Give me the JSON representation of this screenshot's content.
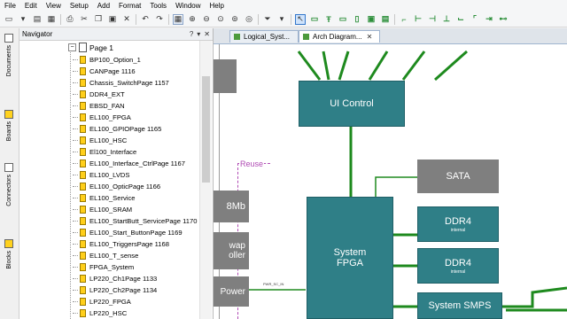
{
  "menu": [
    "File",
    "Edit",
    "View",
    "Setup",
    "Add",
    "Format",
    "Tools",
    "Window",
    "Help"
  ],
  "navigator": {
    "title": "Navigator",
    "buttons": [
      "?",
      "▾",
      "✕"
    ],
    "page_label": "Page 1",
    "items": [
      "BP100_Option_1",
      "CANPage 1116",
      "Chassis_SwitchPage 1157",
      "DDR4_EXT",
      "EBSD_FAN",
      "EL100_FPGA",
      "EL100_GPIOPage 1165",
      "EL100_HSC",
      "El100_Interface",
      "EL100_Interface_CtrlPage 1167",
      "EL100_LVDS",
      "EL100_OpticPage 1166",
      "EL100_Service",
      "EL100_SRAM",
      "EL100_StartButt_ServicePage 1170",
      "EL100_Start_ButtonPage 1169",
      "EL100_TriggersPage 1168",
      "EL100_T_sense",
      "FPGA_System",
      "LP220_Ch1Page 1133",
      "LP220_Ch2Page 1134",
      "LP220_FPGA",
      "LP220_HSC"
    ]
  },
  "sidebar_tabs": [
    "Documents",
    "Boards",
    "Connectors",
    "Blocks"
  ],
  "tabs": [
    {
      "label": "Logical_Syst...",
      "active": false
    },
    {
      "label": "Arch Diagram...",
      "active": true,
      "close": "✕"
    }
  ],
  "diagram": {
    "reuse_label": "Reuse",
    "ui_control": "UI Control",
    "sata": "SATA",
    "ddr4_a": {
      "label": "DDR4",
      "sub": "internal"
    },
    "ddr4_b": {
      "label": "DDR4",
      "sub": "internal"
    },
    "system_fpga": [
      "System",
      "FPGA"
    ],
    "system_smps": "System SMPS",
    "left_8mb": "8Mb",
    "left_wap": [
      "wap",
      "oller"
    ],
    "left_power": "Power",
    "net_label": "PWR_SC_IN"
  },
  "colors": {
    "teal": "#2f7f87",
    "grey": "#7f7f7f",
    "wire": "#1e8a1e",
    "reuse": "#b04bb4"
  }
}
